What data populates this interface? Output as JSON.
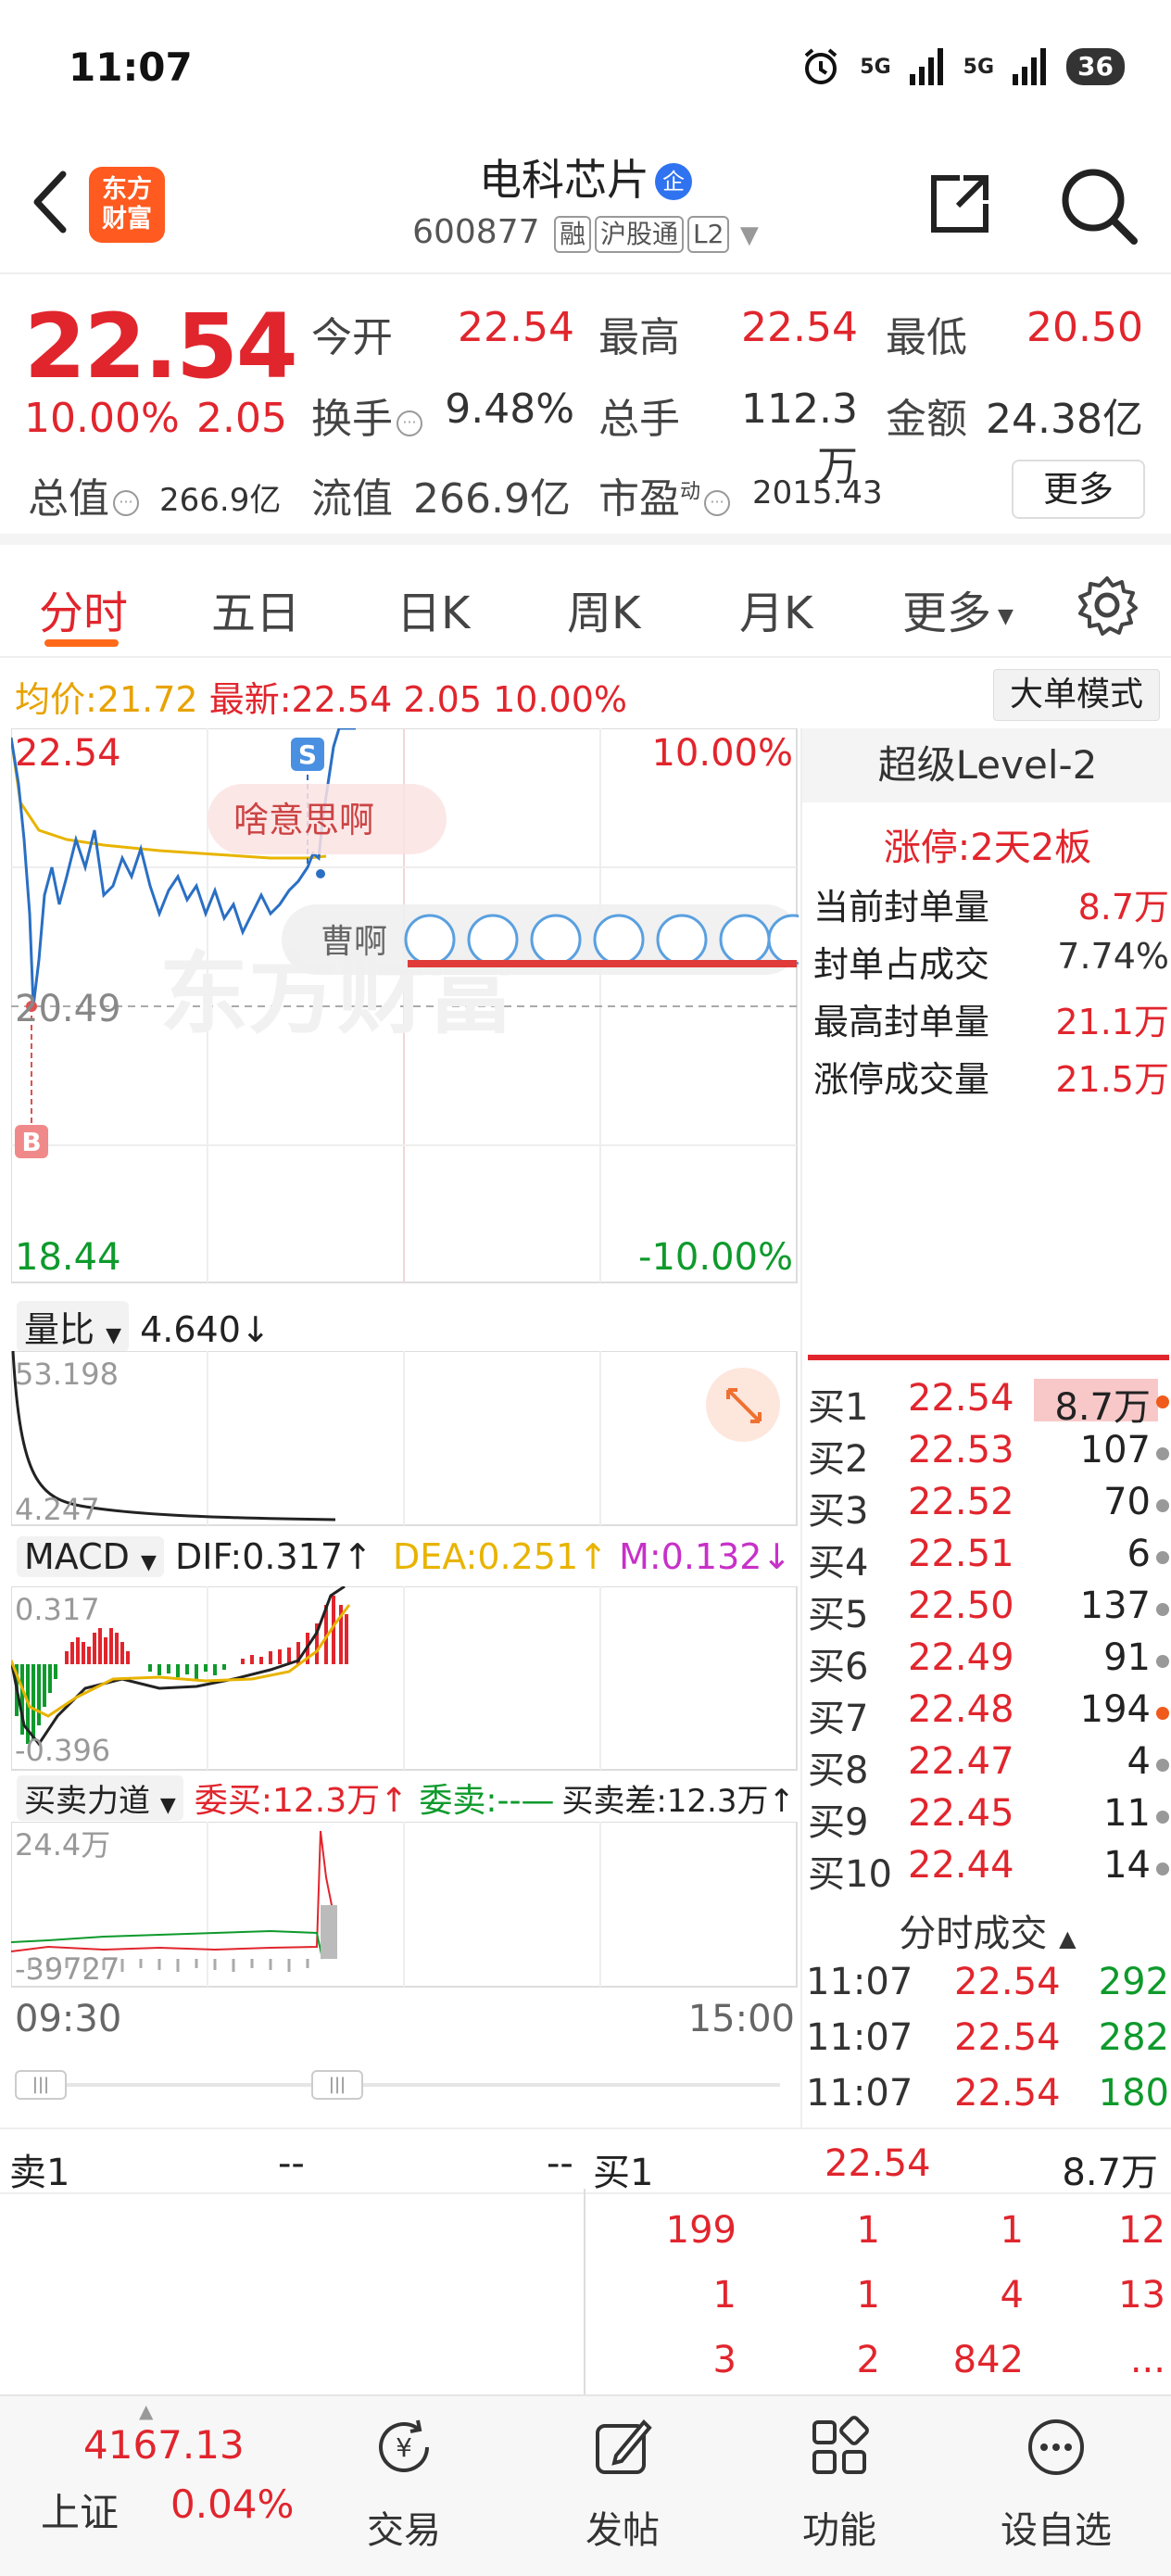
{
  "status_bar": {
    "time": "11:07",
    "signal1": "5G",
    "signal2": "5G",
    "battery": "36"
  },
  "header": {
    "brand": [
      "东方",
      "财富"
    ],
    "title": "电科芯片",
    "enterprise_badge": "企",
    "code": "600877",
    "tags": [
      "融",
      "沪股通",
      "L2"
    ]
  },
  "quote": {
    "price": "22.54",
    "change_pct": "10.00%",
    "change_val": "2.05",
    "open_label": "今开",
    "open": "22.54",
    "high_label": "最高",
    "high": "22.54",
    "low_label": "最低",
    "low": "20.50",
    "turnover_label": "换手",
    "turnover": "9.48%",
    "volume_label": "总手",
    "volume": "112.3万",
    "amount_label": "金额",
    "amount": "24.38亿",
    "mktcap_label": "总值",
    "mktcap": "266.9亿",
    "float_label": "流值",
    "float": "266.9亿",
    "pe_label": "市盈",
    "pe_sup": "动",
    "pe": "2015.43",
    "more": "更多"
  },
  "tabs": [
    "分时",
    "五日",
    "日K",
    "周K",
    "月K",
    "更多"
  ],
  "avg_bar": {
    "avg_label": "均价:",
    "avg": "21.72",
    "latest_label": "最新:",
    "latest": "22.54",
    "latest_chg": "2.05",
    "latest_pct": "10.00%",
    "big_order_button": "大单模式"
  },
  "intraday": {
    "top_price": "22.54",
    "top_pct": "10.00%",
    "ref_price": "20.49",
    "bottom_price": "18.44",
    "bottom_pct": "-10.00%",
    "marker_s": "S",
    "marker_b": "B",
    "bubble1": "啥意思啊",
    "bubble2": "曹啊",
    "watermark": "东方财富"
  },
  "volume_ratio": {
    "label": "量比",
    "value": "4.640↓",
    "top": "53.198",
    "bottom": "4.247"
  },
  "macd": {
    "label": "MACD",
    "dif": "DIF:0.317↑",
    "dea": "DEA:0.251↑",
    "m": "M:0.132↓",
    "top": "0.317",
    "bottom": "-0.396"
  },
  "buysell": {
    "label": "买卖力道",
    "buy": "委买:12.3万↑",
    "sell": "委卖:--—",
    "diff": "买卖差:12.3万↑",
    "top": "24.4万",
    "bottom": "-39727"
  },
  "time_axis": {
    "start": "09:30",
    "end": "15:00"
  },
  "l2": {
    "title": "超级Level-2",
    "limit_up": "涨停:2天2板",
    "rows": [
      {
        "label": "当前封单量",
        "value": "8.7万"
      },
      {
        "label": "封单占成交",
        "value": "7.74%"
      },
      {
        "label": "最高封单量",
        "value": "21.1万"
      },
      {
        "label": "涨停成交量",
        "value": "21.5万"
      }
    ]
  },
  "bids": [
    {
      "label": "买1",
      "price": "22.54",
      "vol": "8.7万"
    },
    {
      "label": "买2",
      "price": "22.53",
      "vol": "107"
    },
    {
      "label": "买3",
      "price": "22.52",
      "vol": "70"
    },
    {
      "label": "买4",
      "price": "22.51",
      "vol": "6"
    },
    {
      "label": "买5",
      "price": "22.50",
      "vol": "137"
    },
    {
      "label": "买6",
      "price": "22.49",
      "vol": "91"
    },
    {
      "label": "买7",
      "price": "22.48",
      "vol": "194"
    },
    {
      "label": "买8",
      "price": "22.47",
      "vol": "4"
    },
    {
      "label": "买9",
      "price": "22.45",
      "vol": "11"
    },
    {
      "label": "买10",
      "price": "22.44",
      "vol": "14"
    }
  ],
  "trades_header": "分时成交",
  "trades": [
    {
      "time": "11:07",
      "price": "22.54",
      "vol": "292"
    },
    {
      "time": "11:07",
      "price": "22.54",
      "vol": "282"
    },
    {
      "time": "11:07",
      "price": "22.54",
      "vol": "180"
    }
  ],
  "order_table": {
    "sell_label": "卖1",
    "sell_price": "--",
    "sell_vol": "--",
    "buy_label": "买1",
    "buy_price": "22.54",
    "buy_vol": "8.7万",
    "queue": [
      [
        "199",
        "1",
        "1",
        "12"
      ],
      [
        "1",
        "1",
        "4",
        "13"
      ],
      [
        "3",
        "2",
        "842",
        "..."
      ]
    ]
  },
  "bottom_nav": {
    "index_value": "4167.13",
    "index_name": "上证",
    "index_pct": "0.04%",
    "items": [
      "交易",
      "发帖",
      "功能",
      "设自选"
    ]
  }
}
